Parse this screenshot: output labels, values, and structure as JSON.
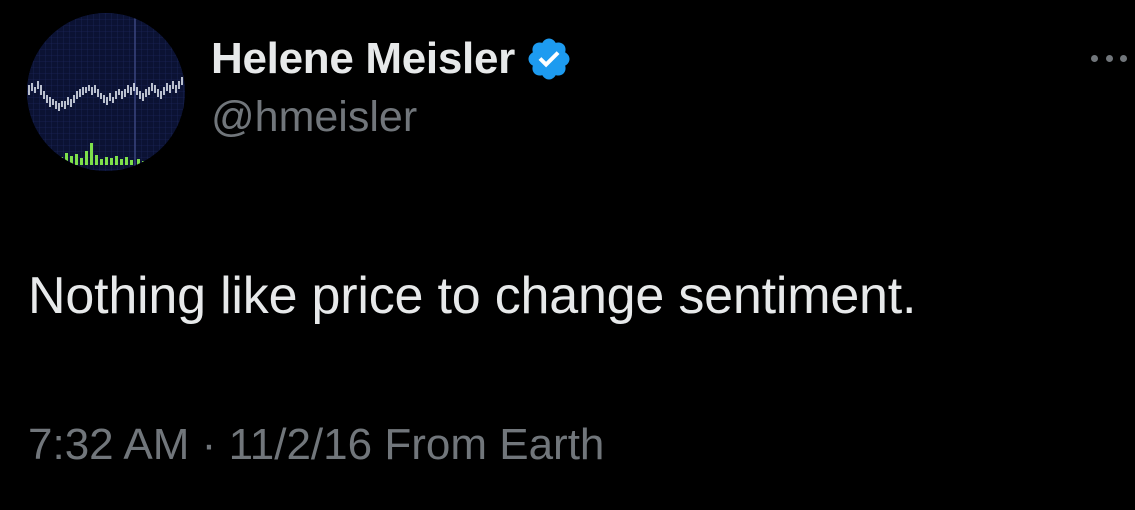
{
  "author": {
    "display_name": "Helene Meisler",
    "handle": "@hmeisler",
    "verified": true,
    "avatar_icon": "stock-chart-avatar-icon",
    "verified_icon": "verified-badge-icon"
  },
  "tweet": {
    "text": "Nothing like price to change sentiment.",
    "time": "7:32 AM",
    "separator": "·",
    "date": "11/2/16",
    "source": "From Earth"
  },
  "menu": {
    "icon": "more-options-icon"
  },
  "colors": {
    "background": "#000000",
    "primary_text": "#e7e9ea",
    "secondary_text": "#71767b",
    "verified_blue": "#1d9bf0",
    "avatar_bg": "#0b1233",
    "avatar_line": "#e6ecf5",
    "avatar_volume": "#7ee04b"
  }
}
